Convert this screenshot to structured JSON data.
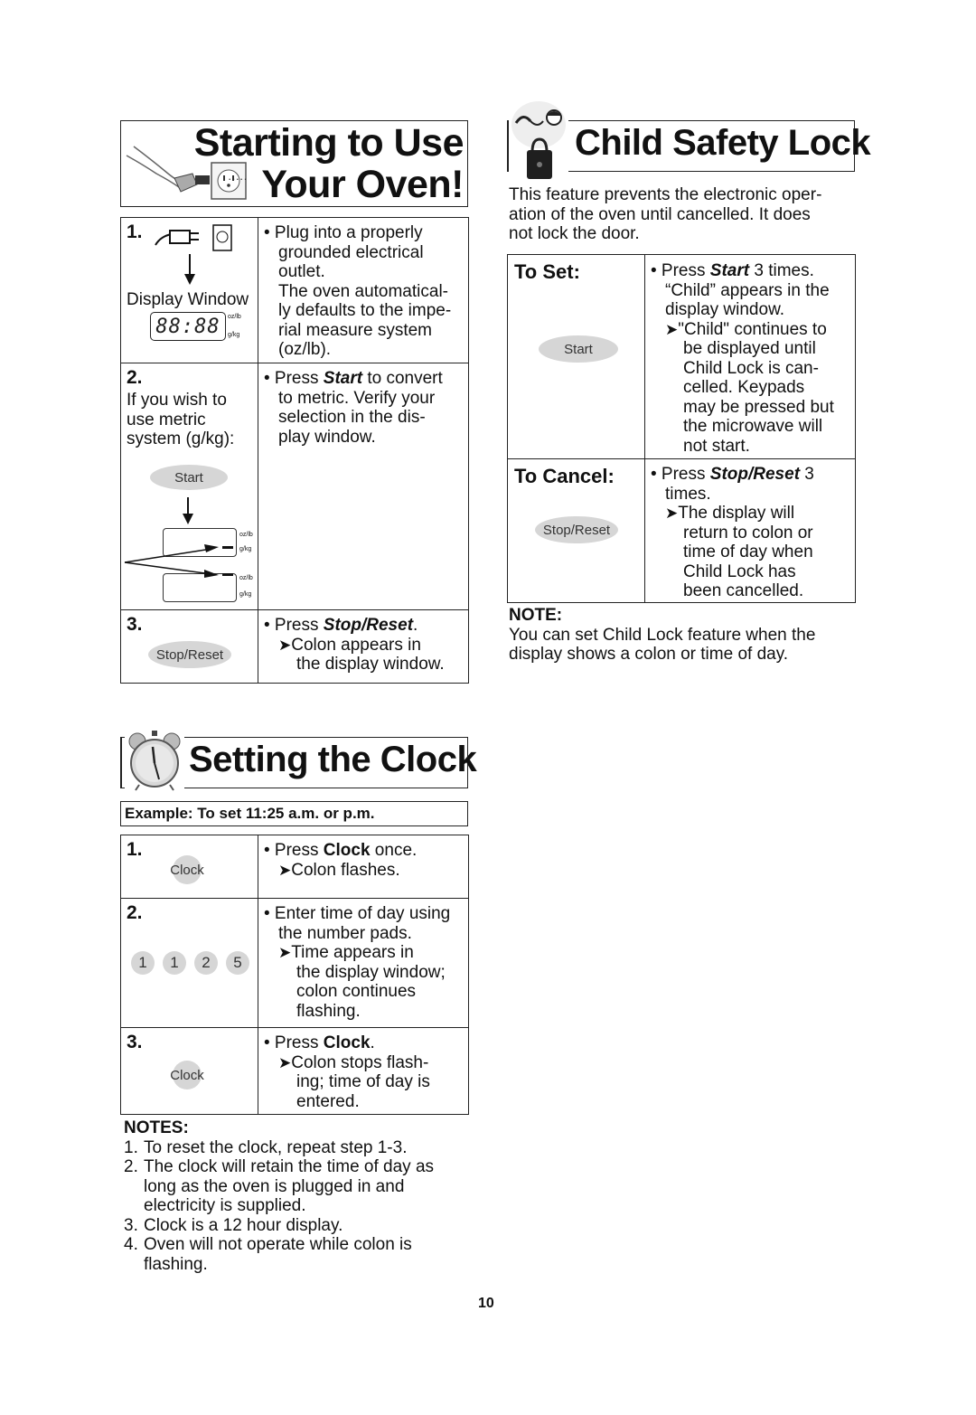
{
  "starting": {
    "title_line1": "Starting to Use",
    "title_line2": "Your Oven!",
    "step1": {
      "num": "1.",
      "display_label": "Display Window",
      "display_digits": "88:88",
      "unit_imperial": "oz/lb",
      "unit_metric": "g/kg",
      "lines": [
        "• Plug into a properly",
        "grounded electrical",
        "outlet.",
        "The oven automatical-",
        "ly defaults to the impe-",
        "rial measure system",
        "(oz/lb)."
      ]
    },
    "step2": {
      "num": "2.",
      "left_lines": [
        "If you wish to",
        "use metric",
        "system (g/kg):"
      ],
      "button": "Start",
      "unit_imperial": "oz/lb",
      "unit_metric": "g/kg",
      "lines": [
        "• Press ",
        "Start",
        " to convert",
        "to metric. Verify your",
        "selection in the dis-",
        "play window."
      ]
    },
    "step3": {
      "num": "3.",
      "button": "Stop/Reset",
      "line1_prefix": "• Press ",
      "line1_bold": "Stop/Reset",
      "line1_suffix": ".",
      "arrow": "➤",
      "lines": [
        "Colon appears in",
        "the display window."
      ]
    }
  },
  "child_lock": {
    "title": "Child Safety Lock",
    "intro": [
      "This feature prevents the electronic oper-",
      "ation of the oven until cancelled. It does",
      "not lock the door."
    ],
    "to_set": {
      "label": "To Set:",
      "button": "Start",
      "line1_prefix": "• Press ",
      "line1_bold": "Start",
      "line1_suffix": " 3 times.",
      "lines_a": [
        "“Child” appears in the",
        "display window."
      ],
      "arrow": "➤",
      "lines_b": [
        "\"Child\" continues to",
        "be displayed until",
        "Child Lock is can-",
        "celled. Keypads",
        "may be pressed but",
        "the microwave will",
        "not start."
      ]
    },
    "to_cancel": {
      "label": "To Cancel:",
      "button": "Stop/Reset",
      "line1_prefix": "• Press ",
      "line1_bold": "Stop/Reset",
      "line1_suffix": " 3",
      "line2": "times.",
      "arrow": "➤",
      "lines_b": [
        "The display will",
        "return to colon or",
        "time of day when",
        "Child Lock has",
        "been cancelled."
      ]
    },
    "note_label": "NOTE:",
    "note_lines": [
      "You can set Child Lock feature when the",
      "display shows a colon or time of day."
    ]
  },
  "clock": {
    "title": "Setting the Clock",
    "example": "Example: To set 11:25 a.m. or p.m.",
    "step1": {
      "num": "1.",
      "button": "Clock",
      "line1_prefix": "• Press ",
      "line1_bold": "Clock",
      "line1_suffix": " once.",
      "arrow": "➤",
      "line2": "Colon flashes."
    },
    "step2": {
      "num": "2.",
      "pads": [
        "1",
        "1",
        "2",
        "5"
      ],
      "lines_a": [
        "• Enter time of day using",
        "the number pads."
      ],
      "arrow": "➤",
      "lines_b": [
        "Time appears in",
        "the display window;",
        "colon continues",
        "flashing."
      ]
    },
    "step3": {
      "num": "3.",
      "button": "Clock",
      "line1_prefix": "• Press ",
      "line1_bold": "Clock",
      "line1_suffix": ".",
      "arrow": "➤",
      "lines_b": [
        "Colon stops flash-",
        "ing; time of day is",
        "entered."
      ]
    },
    "notes_label": "NOTES:",
    "notes": [
      {
        "num": "1.",
        "lines": [
          "To reset the clock, repeat step 1-3."
        ]
      },
      {
        "num": "2.",
        "lines": [
          "The clock will retain the time of day as",
          "long as the oven is plugged in and",
          "electricity is supplied."
        ]
      },
      {
        "num": "3.",
        "lines": [
          "Clock is a 12 hour display."
        ]
      },
      {
        "num": "4.",
        "lines": [
          "Oven will not operate while colon is",
          "flashing."
        ]
      }
    ]
  },
  "page_number": "10"
}
